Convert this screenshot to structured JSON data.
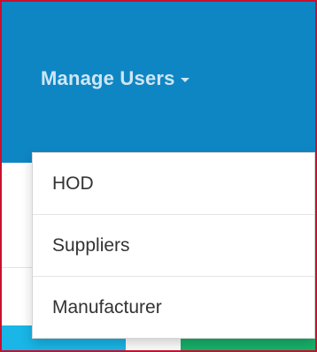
{
  "navbar": {
    "manage_users_label": "Manage Users"
  },
  "dropdown": {
    "items": [
      {
        "label": "HOD"
      },
      {
        "label": "Suppliers"
      },
      {
        "label": "Manufacturer"
      }
    ]
  },
  "colors": {
    "navbar_bg": "#0f86c4",
    "nav_text": "#cfe6f4",
    "frame_border": "#c8102e",
    "strip_cyan": "#19b6e7",
    "strip_green": "#17b26a"
  },
  "icons": {
    "dropdown_caret": "chevron-down-icon"
  }
}
